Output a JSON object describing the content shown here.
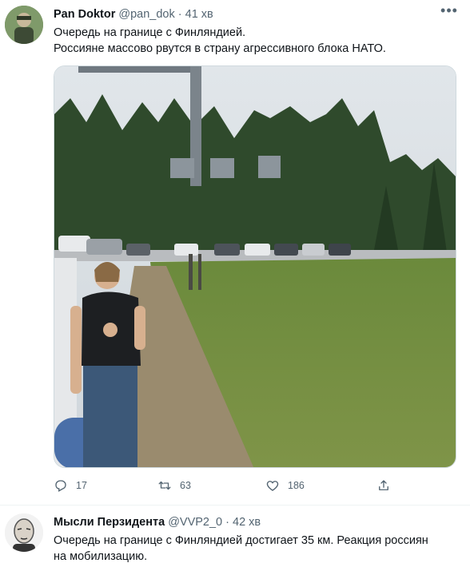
{
  "tweets": [
    {
      "name": "Pan Doktor",
      "handle": "@pan_dok",
      "time": "41 хв",
      "lines": [
        "Очередь на границе с Финляндией.",
        "Россияне массово рвутся в страну агрессивного блока НАТО."
      ],
      "stats": {
        "replies": "17",
        "retweets": "63",
        "likes": "186"
      }
    },
    {
      "name": "Мысли Перзидента",
      "handle": "@VVP2_0",
      "time": "42 хв",
      "lines": [
        "Очередь на границе с Финляндией достигает 35 км. Реакция россиян",
        "на мобилизацию."
      ]
    }
  ],
  "icons": {
    "more": "more-dots-icon",
    "reply": "reply-icon",
    "retweet": "retweet-icon",
    "like": "heart-icon",
    "share": "share-icon"
  },
  "colors": {
    "text": "#0f1419",
    "muted": "#536471",
    "border": "#cfd9de",
    "sky": "#d8dee3",
    "grass": "#6f8b3f",
    "trees": "#2f4a2c"
  }
}
